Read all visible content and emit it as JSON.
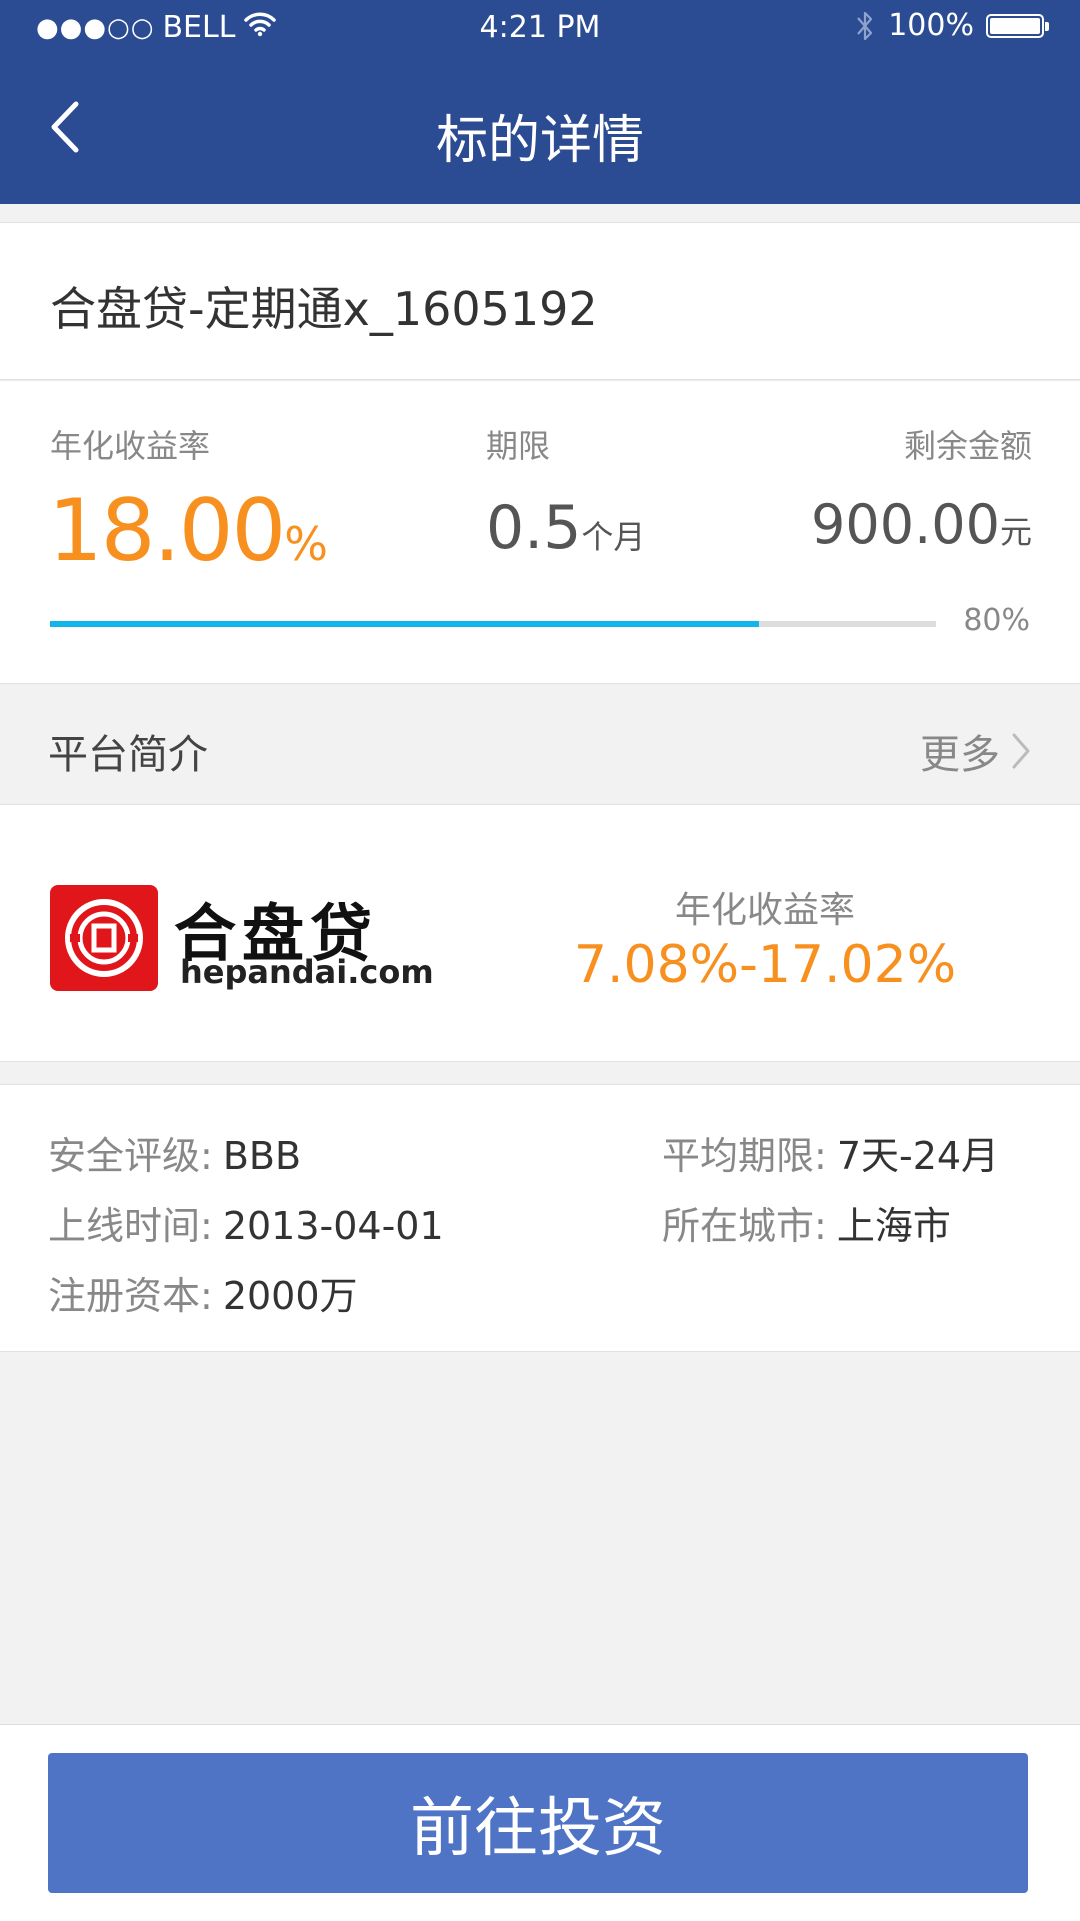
{
  "status_bar": {
    "signal_dots": "●●●○○",
    "carrier": "BELL",
    "time": "4:21 PM",
    "battery": "100%"
  },
  "header": {
    "title": "标的详情",
    "back_icon": "chevron-left-icon"
  },
  "product": {
    "name": "合盘贷-定期通x_1605192",
    "rate_label": "年化收益率",
    "rate_value": "18.00",
    "rate_unit": "%",
    "term_label": "期限",
    "term_value": "0.5",
    "term_unit": "个月",
    "remaining_label": "剩余金额",
    "remaining_value": "900.00",
    "remaining_unit": "元",
    "progress_text": "80%",
    "progress_fraction": 0.8
  },
  "platform_intro": {
    "title": "平台简介",
    "more_label": "更多",
    "more_icon": "chevron-right-icon"
  },
  "platform": {
    "logo_cn": "合盘贷",
    "logo_en": "hepandai.com",
    "rate_label": "年化收益率",
    "rate_range": "7.08%-17.02%"
  },
  "info": {
    "security_rating_label": "安全评级:",
    "security_rating_value": "BBB",
    "avg_term_label": "平均期限:",
    "avg_term_value": "7天-24月",
    "online_date_label": "上线时间:",
    "online_date_value": "2013-04-01",
    "city_label": "所在城市:",
    "city_value": "上海市",
    "registered_capital_label": "注册资本:",
    "registered_capital_value": "2000万"
  },
  "action": {
    "invest_label": "前往投资"
  },
  "colors": {
    "header_bg": "#2b4b93",
    "accent_orange": "#f7901e",
    "progress_blue": "#12b5ea",
    "button_blue": "#5074c5"
  }
}
